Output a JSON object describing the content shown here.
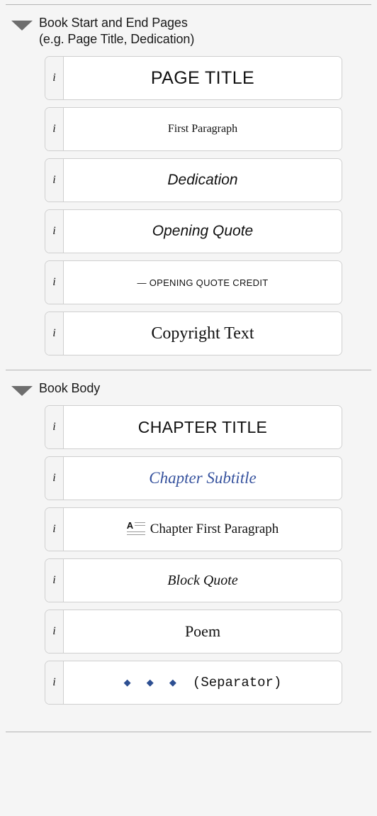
{
  "panel": {
    "background_color": "#f5f5f5",
    "accent_blue": "#37539e",
    "separator_diamond_color": "#2d4f92",
    "divider_color": "#b4b4b4",
    "info_glyph": "i"
  },
  "sections": [
    {
      "id": "book-start-end-pages",
      "title": "Book Start and End Pages",
      "subtitle": "(e.g. Page Title, Dedication)",
      "expanded": true,
      "disclosure_icon": "triangle-down-icon",
      "rows": [
        {
          "id": "page-title",
          "label": "PAGE TITLE",
          "info": "i"
        },
        {
          "id": "first-paragraph",
          "label": "First Paragraph",
          "info": "i"
        },
        {
          "id": "dedication",
          "label": "Dedication",
          "info": "i"
        },
        {
          "id": "opening-quote",
          "label": "Opening Quote",
          "info": "i"
        },
        {
          "id": "opening-quote-credit",
          "label": "— OPENING QUOTE CREDIT",
          "info": "i"
        },
        {
          "id": "copyright-text",
          "label": "Copyright Text",
          "info": "i"
        }
      ]
    },
    {
      "id": "book-body",
      "title": "Book Body",
      "subtitle": "",
      "expanded": true,
      "disclosure_icon": "triangle-down-icon",
      "rows": [
        {
          "id": "chapter-title",
          "label": "CHAPTER TITLE",
          "info": "i"
        },
        {
          "id": "chapter-subtitle",
          "label": "Chapter Subtitle",
          "info": "i"
        },
        {
          "id": "chapter-first-paragraph",
          "label": "Chapter First Paragraph",
          "info": "i",
          "icon": "drop-cap-icon"
        },
        {
          "id": "block-quote",
          "label": "Block Quote",
          "info": "i"
        },
        {
          "id": "poem",
          "label": "Poem",
          "info": "i"
        },
        {
          "id": "separator",
          "label": "(Separator)",
          "info": "i",
          "ornament": "◆ ◆ ◆"
        }
      ]
    }
  ]
}
